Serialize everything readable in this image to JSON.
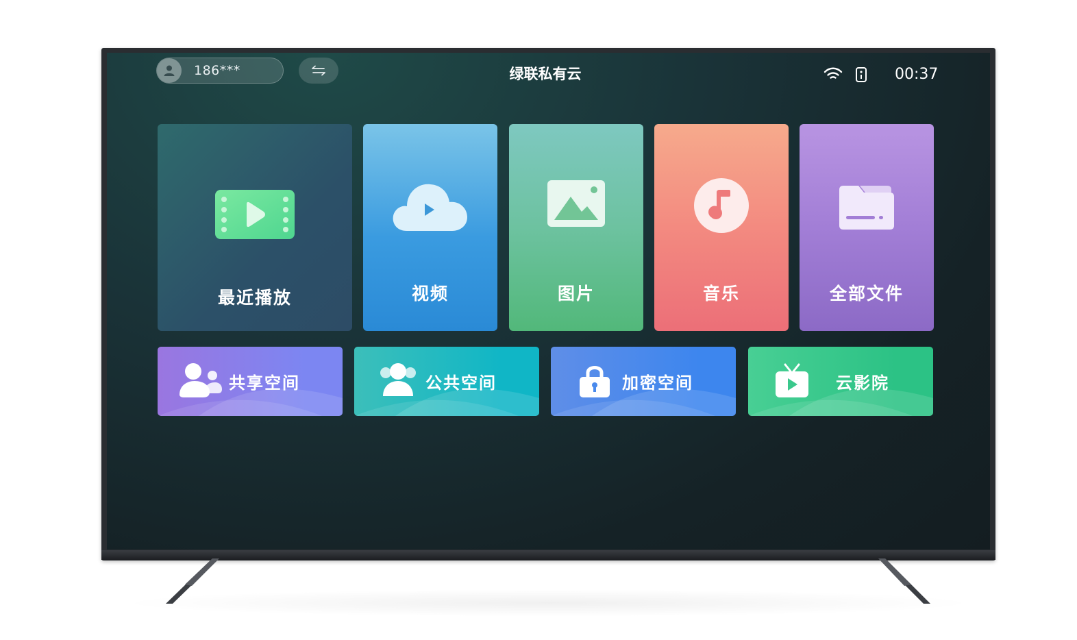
{
  "header": {
    "user_account": "186***",
    "app_title": "绿联私有云",
    "clock": "00:37"
  },
  "icons": {
    "avatar": "person-icon",
    "switch": "swap-arrows-icon",
    "wifi": "wifi-icon",
    "remote": "remote-control-icon"
  },
  "main_tiles": [
    {
      "label": "最近播放",
      "icon": "film-play-icon"
    },
    {
      "label": "视频",
      "icon": "cloud-play-icon"
    },
    {
      "label": "图片",
      "icon": "image-icon"
    },
    {
      "label": "音乐",
      "icon": "music-note-icon"
    },
    {
      "label": "全部文件",
      "icon": "folder-icon"
    }
  ],
  "space_tiles": [
    {
      "label": "共享空间",
      "icon": "users-icon"
    },
    {
      "label": "公共空间",
      "icon": "group-icon"
    },
    {
      "label": "加密空间",
      "icon": "lock-icon"
    },
    {
      "label": "云影院",
      "icon": "tv-play-icon"
    }
  ],
  "colors": {
    "screen_bg": "#17272b",
    "recent": "#2c5068",
    "video": "#3a9be0",
    "photo": "#6dc2a0",
    "music": "#ef7f7c",
    "files": "#a27ed6",
    "shared": "#8a7ee8",
    "public": "#22bac0",
    "secure": "#4a8aec",
    "cinema": "#3ac88c"
  }
}
